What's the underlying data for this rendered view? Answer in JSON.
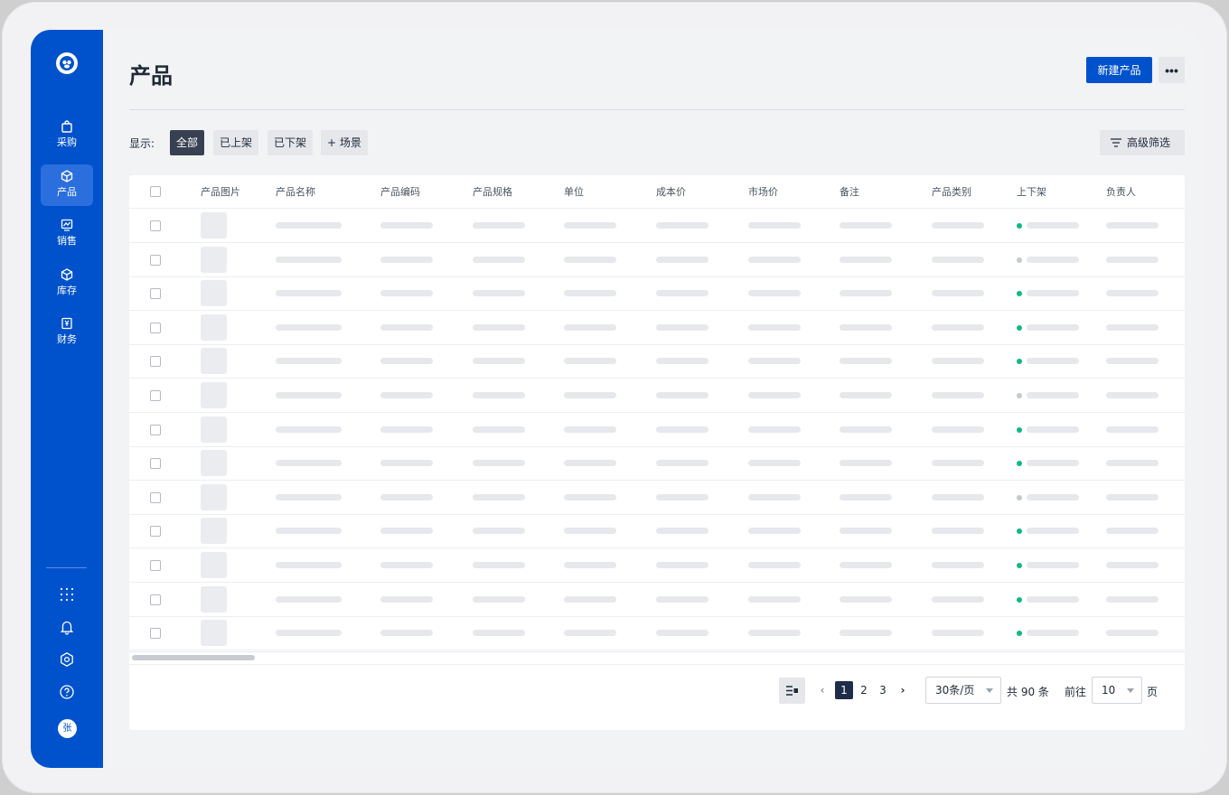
{
  "app": {
    "sidebar": {
      "items": [
        {
          "label": "采购",
          "icon": "shopping-bag-icon"
        },
        {
          "label": "产品",
          "icon": "box-icon",
          "active": true
        },
        {
          "label": "销售",
          "icon": "chart-icon"
        },
        {
          "label": "库存",
          "icon": "cube-icon"
        },
        {
          "label": "财务",
          "icon": "yuan-icon"
        }
      ],
      "bottom_icons": [
        "apps-grid-icon",
        "bell-icon",
        "settings-hexagon-icon",
        "help-icon"
      ],
      "avatar_text": "张"
    },
    "page_title": "产品",
    "primary_button": "新建产品",
    "more_button": "•••",
    "filter_label": "显示:",
    "filter_chips": [
      "全部",
      "已上架",
      "已下架",
      "+ 场景"
    ],
    "advanced_filter": "高级筛选",
    "table": {
      "columns": [
        "产品图片",
        "产品名称",
        "产品编码",
        "产品规格",
        "单位",
        "成本价",
        "市场价",
        "备注",
        "产品类别",
        "上下架",
        "负责人"
      ],
      "row_status": [
        "on",
        "off",
        "on",
        "on",
        "on",
        "off",
        "on",
        "on",
        "off",
        "on",
        "on",
        "on",
        "on"
      ]
    },
    "pagination": {
      "pages": [
        "1",
        "2",
        "3"
      ],
      "current_page": "1",
      "page_size": "30条/页",
      "total_text": "共 90 条",
      "goto_label": "前往",
      "goto_value": "10",
      "page_suffix": "页"
    },
    "colors": {
      "brand": "#0052cc",
      "status_on": "#10b981",
      "status_off": "#c4c8cf"
    }
  }
}
